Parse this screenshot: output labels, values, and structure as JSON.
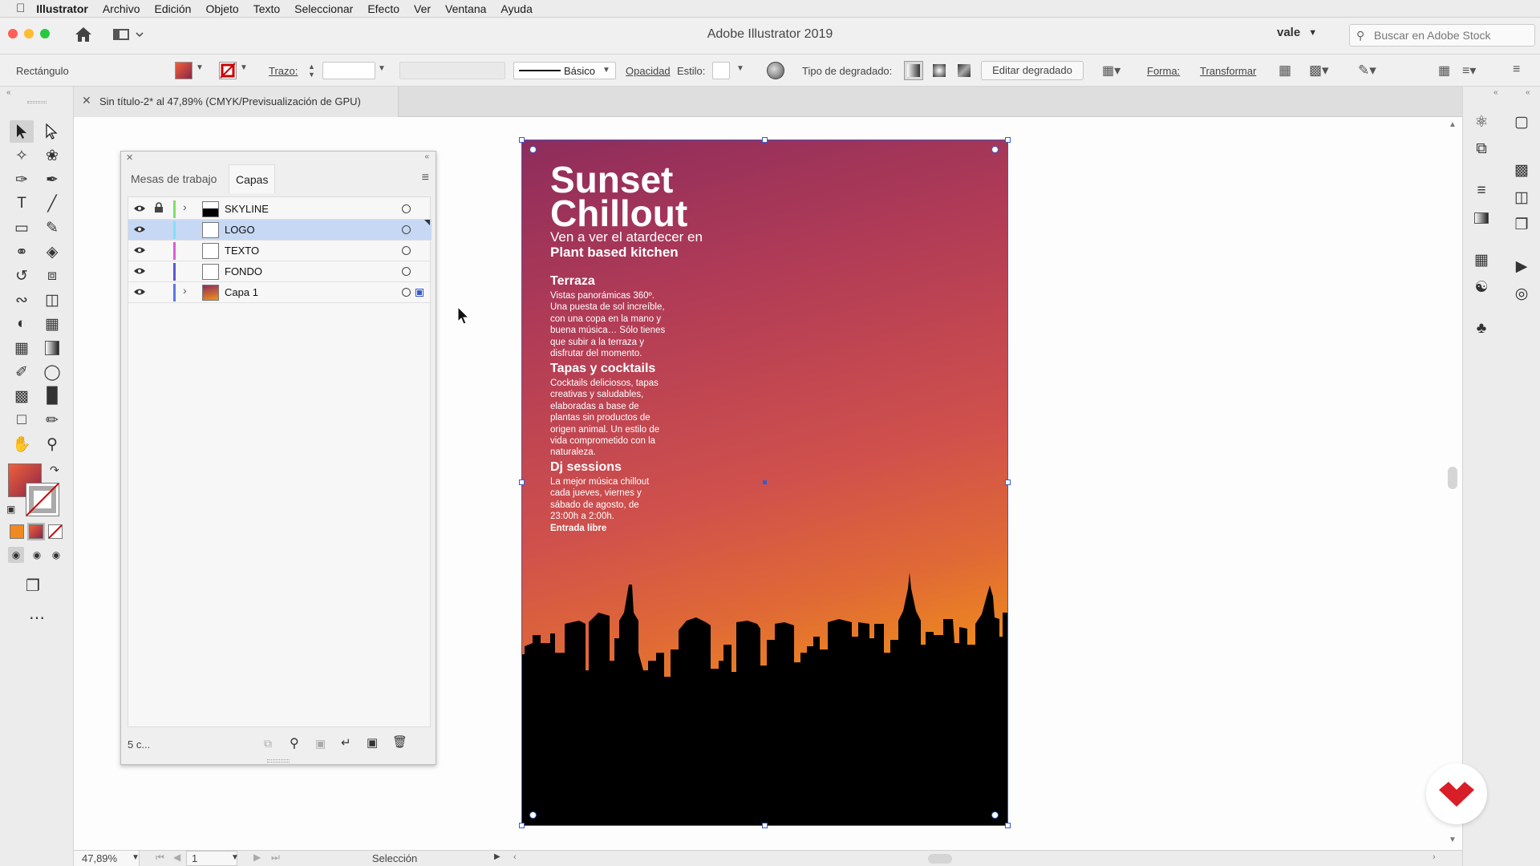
{
  "menubar": {
    "apple_icon": "apple-icon",
    "app_name": "Illustrator",
    "items": [
      "Archivo",
      "Edición",
      "Objeto",
      "Texto",
      "Seleccionar",
      "Efecto",
      "Ver",
      "Ventana",
      "Ayuda"
    ]
  },
  "titlebar": {
    "title": "Adobe Illustrator 2019",
    "workspace": "vale",
    "stock_placeholder": "Buscar en Adobe Stock",
    "colors": {
      "close": "#fe5f57",
      "minimize": "#febc2e",
      "zoom": "#28c840"
    }
  },
  "control": {
    "object_type": "Rectángulo",
    "stroke_label": "Trazo:",
    "brush_label": "Básico",
    "opacity_label": "Opacidad",
    "style_label": "Estilo:",
    "gradient_type_label": "Tipo de degradado:",
    "edit_gradient_button": "Editar degradado",
    "shape_label": "Forma:",
    "transform_label": "Transformar"
  },
  "document_tab": {
    "title": "Sin título-2* al 47,89% (CMYK/Previsualización de GPU)"
  },
  "layers_panel": {
    "tabs": [
      "Mesas de trabajo",
      "Capas"
    ],
    "active_tab": "Capas",
    "layers": [
      {
        "name": "SKYLINE",
        "color": "#7ee06a",
        "expandable": true,
        "locked": true,
        "thumb": "skyline",
        "selected": false
      },
      {
        "name": "LOGO",
        "color": "#80e0ff",
        "expandable": false,
        "locked": false,
        "thumb": "blank",
        "selected": true
      },
      {
        "name": "TEXTO",
        "color": "#e05ad4",
        "expandable": false,
        "locked": false,
        "thumb": "blank",
        "selected": false
      },
      {
        "name": "FONDO",
        "color": "#5a55d8",
        "expandable": false,
        "locked": false,
        "thumb": "blank",
        "selected": false
      },
      {
        "name": "Capa 1",
        "color": "#5a78e8",
        "expandable": true,
        "locked": false,
        "thumb": "gradient",
        "selected": false
      }
    ],
    "footer_count": "5 c..."
  },
  "poster": {
    "title_line1": "Sunset",
    "title_line2": "Chillout",
    "subtitle_line1": "Ven a ver el atardecer en",
    "subtitle_line2": "Plant based kitchen",
    "sections": [
      {
        "heading": "Terraza",
        "lines": [
          "Vistas panorámicas 360º.",
          "Una puesta de sol increíble,",
          "con una copa en la mano y",
          "buena música… Sólo tienes",
          "que subir a la terraza y",
          "disfrutar del momento."
        ]
      },
      {
        "heading": "Tapas y cocktails",
        "lines": [
          "Cocktails deliciosos, tapas",
          "creativas y saludables,",
          "elaboradas a base de",
          "plantas sin productos de",
          "origen animal. Un estilo de",
          "vida comprometido con la",
          "naturaleza."
        ]
      },
      {
        "heading": "Dj sessions",
        "lines": [
          "La mejor música chillout",
          "cada jueves, viernes y",
          "sábado de agosto, de",
          "23:00h a 2:00h."
        ],
        "emphasis": "Entrada libre"
      }
    ],
    "gradient_top": "#8e2c5c",
    "gradient_bottom": "#f29318"
  },
  "statusbar": {
    "zoom": "47,89%",
    "artboard_number": "1",
    "tool_name": "Selección"
  },
  "fill_swatch_colors": {
    "from": "#f0603a",
    "to": "#8a2648"
  }
}
